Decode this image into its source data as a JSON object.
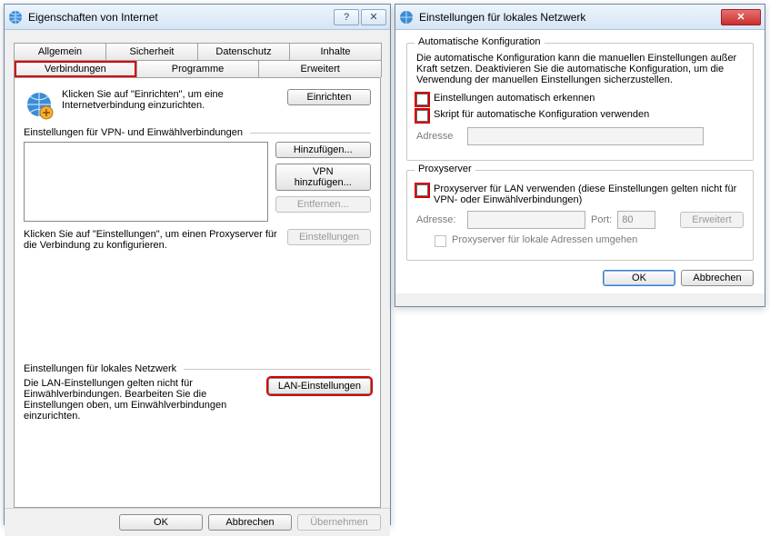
{
  "left": {
    "title": "Eigenschaften von Internet",
    "tabs": {
      "row1": [
        "Allgemein",
        "Sicherheit",
        "Datenschutz",
        "Inhalte"
      ],
      "row2": [
        "Verbindungen",
        "Programme",
        "Erweitert"
      ],
      "active": "Verbindungen"
    },
    "setup": {
      "text": "Klicken Sie auf \"Einrichten\", um eine Internetverbindung einzurichten.",
      "button": "Einrichten"
    },
    "vpn": {
      "section": "Einstellungen für VPN- und Einwählverbindungen",
      "add": "Hinzufügen...",
      "add_vpn": "VPN hinzufügen...",
      "remove": "Entfernen...",
      "settings": "Einstellungen",
      "hint": "Klicken Sie auf \"Einstellungen\", um einen Proxyserver für die Verbindung zu konfigurieren."
    },
    "lan": {
      "section": "Einstellungen für lokales Netzwerk",
      "hint": "Die LAN-Einstellungen gelten nicht für Einwählverbindungen. Bearbeiten Sie die Einstellungen oben, um Einwählverbindungen einzurichten.",
      "button": "LAN-Einstellungen"
    },
    "footer": {
      "ok": "OK",
      "cancel": "Abbrechen",
      "apply": "Übernehmen"
    }
  },
  "right": {
    "title": "Einstellungen für lokales Netzwerk",
    "auto": {
      "title": "Automatische Konfiguration",
      "desc": "Die automatische Konfiguration kann die manuellen Einstellungen außer Kraft setzen. Deaktivieren Sie die automatische Konfiguration, um die Verwendung der manuellen Einstellungen sicherzustellen.",
      "detect": "Einstellungen automatisch erkennen",
      "script": "Skript für automatische Konfiguration verwenden",
      "address_label": "Adresse",
      "address_value": ""
    },
    "proxy": {
      "title": "Proxyserver",
      "use": "Proxyserver für LAN verwenden (diese Einstellungen gelten nicht für VPN- oder Einwählverbindungen)",
      "address_label": "Adresse:",
      "address_value": "",
      "port_label": "Port:",
      "port_value": "80",
      "advanced": "Erweitert",
      "bypass": "Proxyserver für lokale Adressen umgehen"
    },
    "footer": {
      "ok": "OK",
      "cancel": "Abbrechen"
    }
  }
}
